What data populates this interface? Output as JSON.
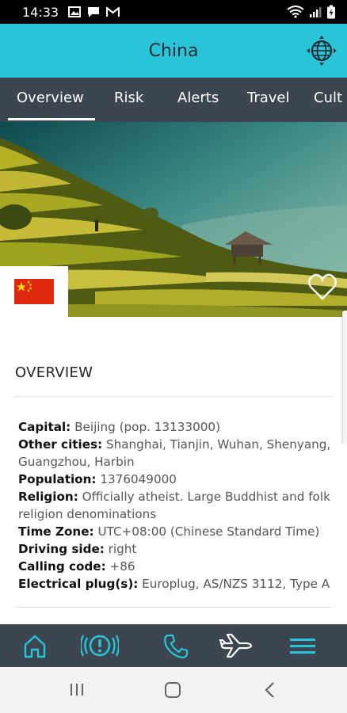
{
  "status_bar": {
    "time": "14:33"
  },
  "header": {
    "title": "China",
    "globe_icon": "globe-crosshair-icon"
  },
  "tabs": [
    {
      "label": "Overview",
      "active": true
    },
    {
      "label": "Risk"
    },
    {
      "label": "Alerts"
    },
    {
      "label": "Travel"
    },
    {
      "label": "Cult"
    }
  ],
  "hero": {
    "flag_icon": "china-flag-icon",
    "favorite_icon": "heart-icon"
  },
  "overview": {
    "title": "OVERVIEW",
    "capital": {
      "label": "Capital:",
      "value": "Beijing (pop. 13133000)"
    },
    "other_cities": {
      "label": "Other cities:",
      "value": "Shanghai, Tianjin, Wuhan, Shenyang, Guangzhou, Harbin"
    },
    "population": {
      "label": "Population:",
      "value": "1376049000"
    },
    "religion": {
      "label": "Religion:",
      "value": "Officially atheist. Large Buddhist and folk religion denominations"
    },
    "time_zone": {
      "label": "Time Zone:",
      "value": "UTC+08:00 (Chinese Standard Time)"
    },
    "driving_side": {
      "label": "Driving side:",
      "value": "right"
    },
    "calling_code": {
      "label": "Calling code:",
      "value": "+86"
    },
    "plugs": {
      "label": "Electrical plug(s):",
      "value": "Europlug, AS/NZS 3112, Type A"
    }
  },
  "bottom_nav": [
    "home-icon",
    "alert-icon",
    "phone-icon",
    "plane-icon",
    "menu-icon"
  ],
  "colors": {
    "accent": "#29c4d8",
    "nav_bg": "#3c4651"
  }
}
